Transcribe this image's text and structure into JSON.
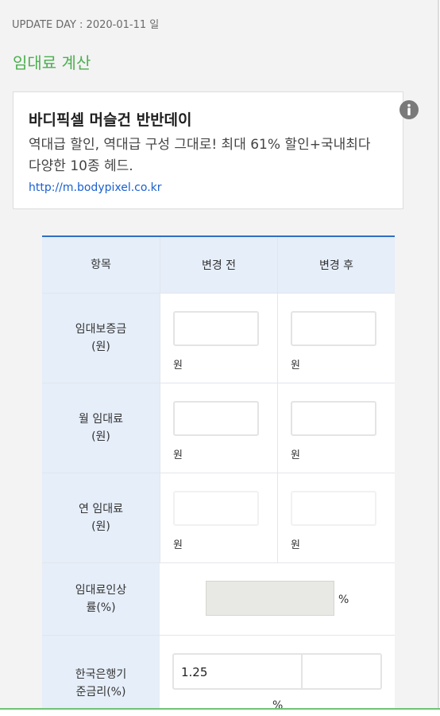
{
  "update_day": "UPDATE DAY : 2020-01-11 일",
  "page_title": "임대료 계산",
  "ad": {
    "title": "바디픽셀 머슬건 반반데이",
    "description": "역대급 할인, 역대급 구성 그대로! 최대 61% 할인+국내최다 다양한 10종 헤드.",
    "url": "http://m.bodypixel.co.kr",
    "icon": "info-icon"
  },
  "table": {
    "headers": [
      "항목",
      "변경 전",
      "변경 후"
    ],
    "rows": [
      {
        "label": "임대보증금\n(원)",
        "before_value": "",
        "after_value": "",
        "unit": "원"
      },
      {
        "label": "월 임대료\n(원)",
        "before_value": "",
        "after_value": "",
        "unit": "원"
      },
      {
        "label": "연 임대료\n(원)",
        "before_value": "",
        "after_value": "",
        "unit": "원"
      }
    ],
    "rate_label": "임대료인상\n률(%)",
    "rate_value": "",
    "rate_unit": "%",
    "base_rate_label": "한국은행기\n준금리(%)",
    "base_rate_value": "1.25",
    "base_rate_unit": "%"
  },
  "colors": {
    "title_green": "#4caf50",
    "table_border_blue": "#2f6fc6",
    "header_bg": "#e6eef9",
    "link_blue": "#1a5fd1"
  }
}
